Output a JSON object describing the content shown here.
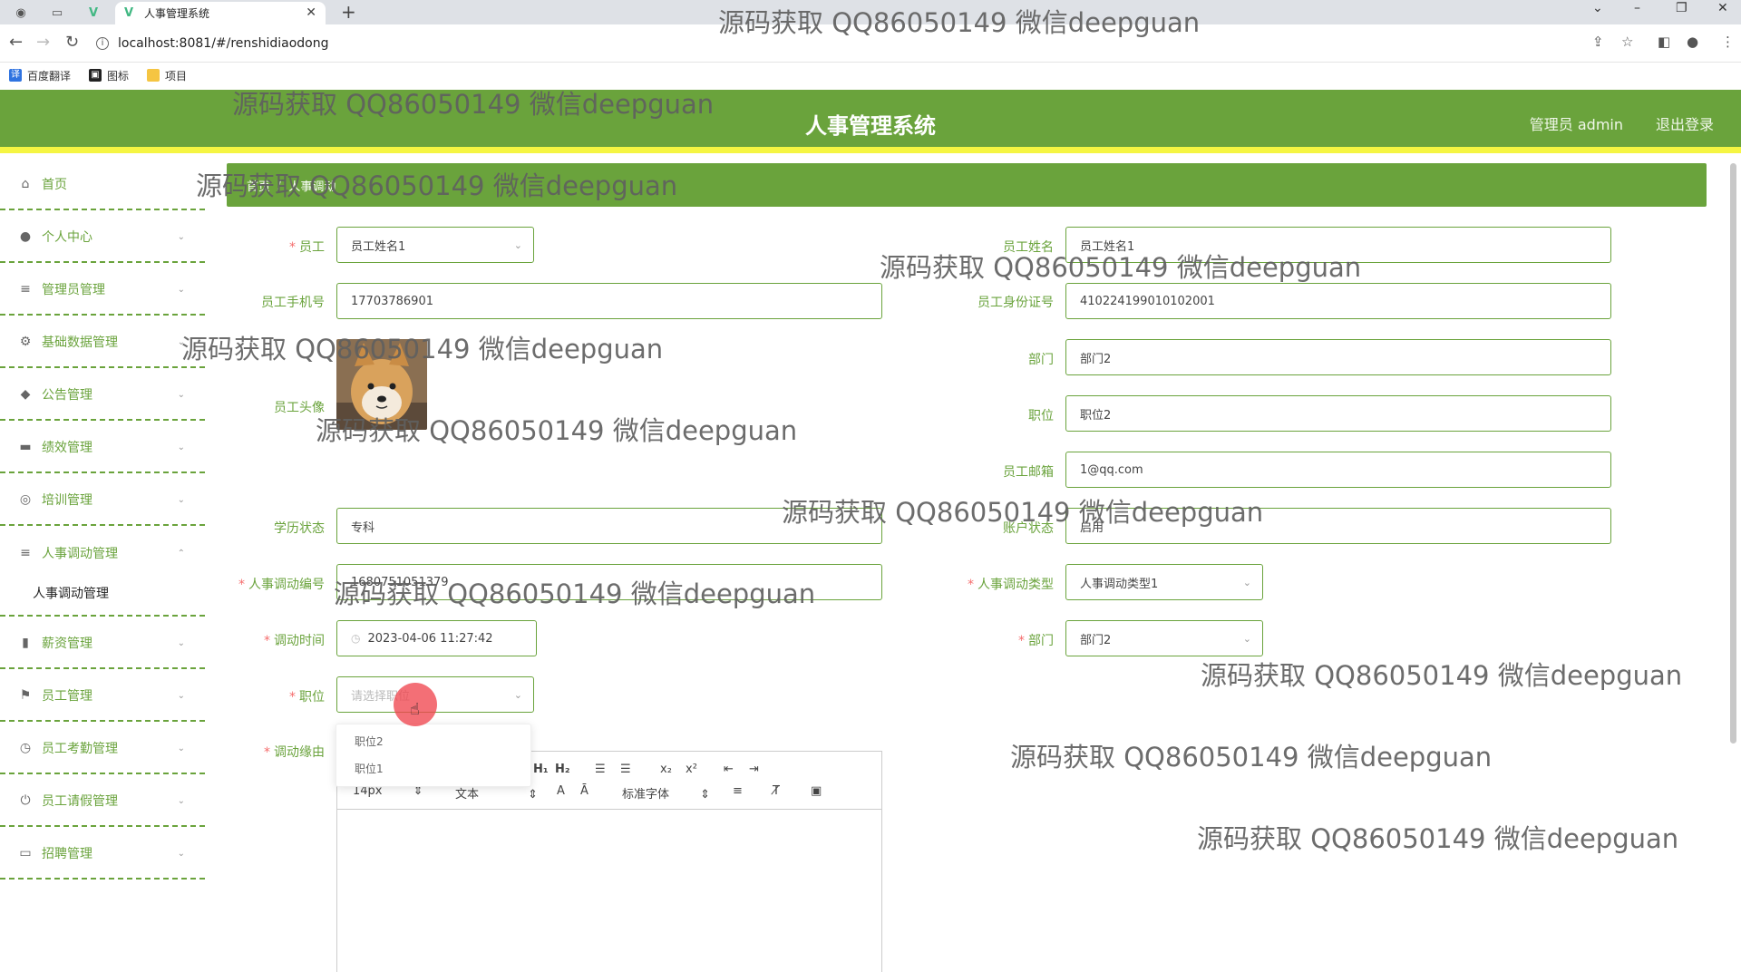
{
  "browser": {
    "tab_title": "人事管理系统",
    "url": "localhost:8081/#/renshidiaodong",
    "bookmarks": [
      "百度翻译",
      "图标",
      "项目"
    ]
  },
  "header": {
    "title": "人事管理系统",
    "user": "管理员 admin",
    "logout": "退出登录",
    "accent_color": "#6aa33c",
    "stripe_color": "#f5f542"
  },
  "sidebar": {
    "items": [
      {
        "label": "首页",
        "icon": "home-icon"
      },
      {
        "label": "个人中心",
        "icon": "user-icon"
      },
      {
        "label": "管理员管理",
        "icon": "menu-icon"
      },
      {
        "label": "基础数据管理",
        "icon": "settings-icon"
      },
      {
        "label": "公告管理",
        "icon": "pin-icon"
      },
      {
        "label": "绩效管理",
        "icon": "chat-icon"
      },
      {
        "label": "培训管理",
        "icon": "compass-icon"
      },
      {
        "label": "人事调动管理",
        "icon": "menu-icon"
      },
      {
        "label": "薪资管理",
        "icon": "bar-chart-icon"
      },
      {
        "label": "员工管理",
        "icon": "flag-icon"
      },
      {
        "label": "员工考勤管理",
        "icon": "clock-icon"
      },
      {
        "label": "员工请假管理",
        "icon": "power-icon"
      },
      {
        "label": "招聘管理",
        "icon": "card-icon"
      }
    ],
    "active_sub": "人事调动管理"
  },
  "breadcrumb": [
    "首页",
    "人事调动"
  ],
  "form": {
    "employee": {
      "label": "员工",
      "value": "员工姓名1"
    },
    "employee_name": {
      "label": "员工姓名",
      "value": "员工姓名1"
    },
    "phone": {
      "label": "员工手机号",
      "value": "17703786901"
    },
    "id_card": {
      "label": "员工身份证号",
      "value": "410224199010102001"
    },
    "department": {
      "label": "部门",
      "value": "部门2"
    },
    "avatar": {
      "label": "员工头像"
    },
    "position": {
      "label": "职位",
      "value": "职位2"
    },
    "email": {
      "label": "员工邮箱",
      "value": "1@qq.com"
    },
    "education": {
      "label": "学历状态",
      "value": "专科"
    },
    "account_status": {
      "label": "账户状态",
      "value": "启用"
    },
    "transfer_no": {
      "label": "人事调动编号",
      "value": "1680751051379"
    },
    "transfer_type": {
      "label": "人事调动类型",
      "value": "人事调动类型1"
    },
    "transfer_time": {
      "label": "调动时间",
      "value": "2023-04-06 11:27:42"
    },
    "new_department": {
      "label": "部门",
      "value": "部门2"
    },
    "new_position": {
      "label": "职位",
      "placeholder": "请选择职位"
    },
    "reason": {
      "label": "调动缘由"
    }
  },
  "dropdown_options": [
    "职位2",
    "职位1"
  ],
  "editor": {
    "font_size": "14px",
    "text_type": "文本",
    "font_family": "标准字体"
  },
  "watermark": "源码获取 QQ86050149 微信deepguan"
}
